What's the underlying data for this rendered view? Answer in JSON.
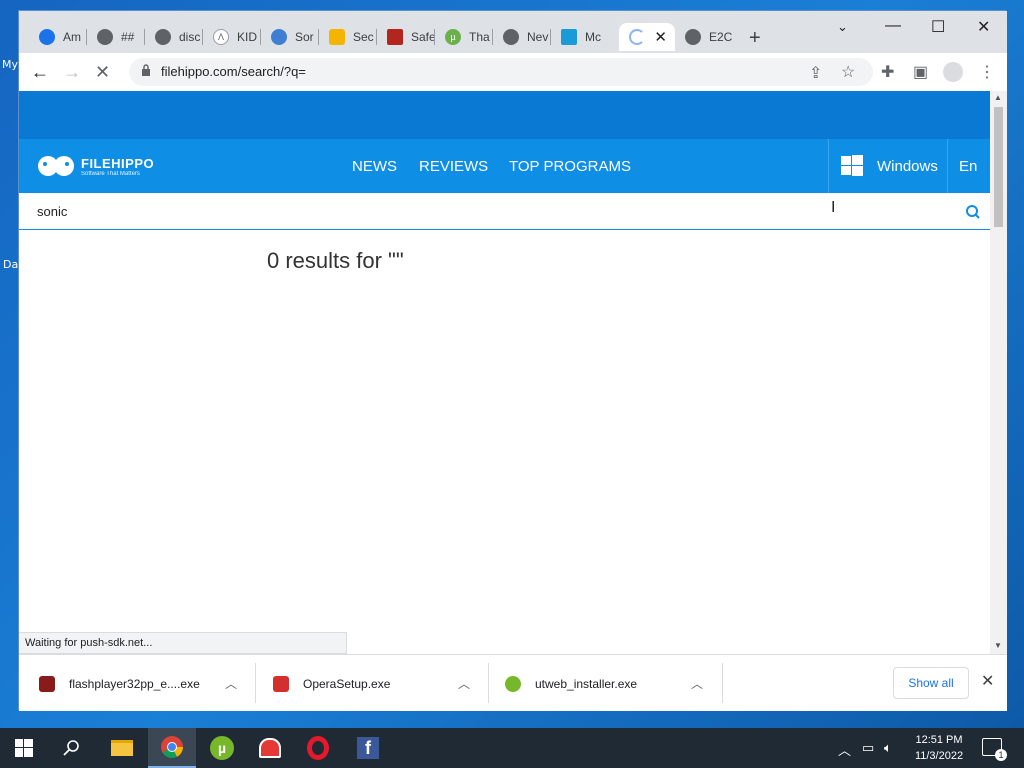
{
  "desktop": {
    "labels": [
      "My",
      "Da"
    ]
  },
  "browser": {
    "tabs": [
      {
        "label": "Am",
        "color": "#1a73e8"
      },
      {
        "label": "##",
        "color": "#5f6368"
      },
      {
        "label": "disc",
        "color": "#5f6368"
      },
      {
        "label": "KID",
        "color": "#9aa0a6"
      },
      {
        "label": "Sor",
        "color": "#3f7fd1"
      },
      {
        "label": "Sec",
        "color": "#f4b400"
      },
      {
        "label": "Safe",
        "color": "#b3261e"
      },
      {
        "label": "Tha",
        "color": "#6ab04c"
      },
      {
        "label": "Nev",
        "color": "#5f6368"
      },
      {
        "label": "Mc",
        "color": "#1a9bd7"
      },
      {
        "label": "",
        "color": "#8ab4f8"
      },
      {
        "label": "E2C",
        "color": "#5f6368"
      }
    ],
    "url": "filehippo.com/search/?q=",
    "status_text": "Waiting for push-sdk.net..."
  },
  "site": {
    "logo_name": "FILEHIPPO",
    "logo_tagline": "Software That Matters",
    "nav": [
      "NEWS",
      "REVIEWS",
      "TOP PROGRAMS"
    ],
    "os_label": "Windows",
    "lang_label": "En",
    "search_value": "sonic",
    "results_text": "0 results for \"\""
  },
  "downloads": {
    "items": [
      {
        "name": "flashplayer32pp_e....exe",
        "color": "#8b1a1a"
      },
      {
        "name": "OperaSetup.exe",
        "color": "#d32f2f"
      },
      {
        "name": "utweb_installer.exe",
        "color": "#76b82a"
      }
    ],
    "show_all": "Show all"
  },
  "taskbar": {
    "time": "12:51 PM",
    "date": "11/3/2022",
    "notification_count": "1"
  }
}
